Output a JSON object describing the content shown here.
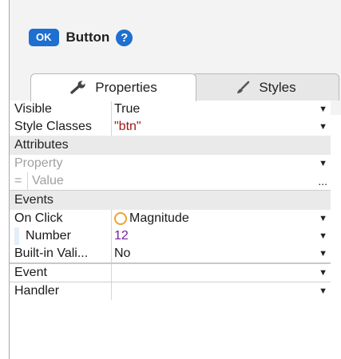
{
  "header": {
    "badge": "OK",
    "title": "Button",
    "help": "?"
  },
  "tabs": [
    {
      "label": "Properties",
      "icon": "wrench-icon",
      "active": true
    },
    {
      "label": "Styles",
      "icon": "brush-icon",
      "active": false
    }
  ],
  "properties": [
    {
      "name": "Visible",
      "value": "True"
    },
    {
      "name": "Style Classes",
      "value": "\"btn\""
    }
  ],
  "attributes": {
    "section": "Attributes",
    "property_placeholder": "Property",
    "equals": "=",
    "value_placeholder": "Value",
    "ellipsis": "..."
  },
  "events": {
    "section": "Events",
    "on_click": {
      "name": "On Click",
      "value": "Magnitude"
    },
    "number": {
      "name": "Number",
      "value": "12"
    },
    "builtin": {
      "name": "Built-in Vali...",
      "value": "No"
    },
    "event": {
      "name": "Event",
      "value": ""
    },
    "handler": {
      "name": "Handler",
      "value": ""
    }
  },
  "colors": {
    "accent": "#1e6fd0",
    "string": "#a31515",
    "number": "#7a1fa2",
    "radio": "#f0a030"
  }
}
